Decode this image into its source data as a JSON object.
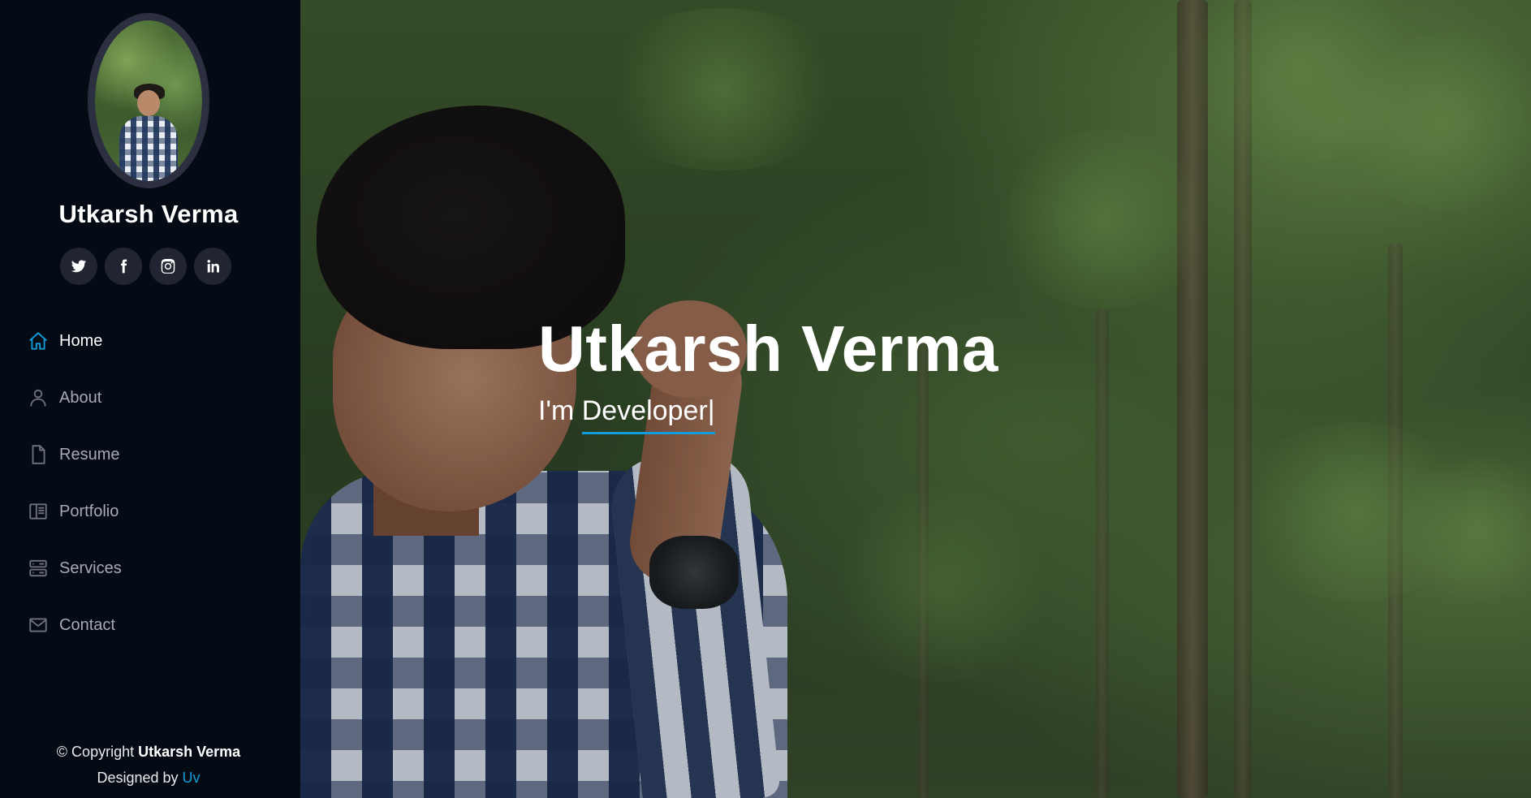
{
  "profile": {
    "name": "Utkarsh Verma",
    "avatar_alt": "profile photo"
  },
  "social": [
    {
      "icon": "twitter-icon"
    },
    {
      "icon": "facebook-icon"
    },
    {
      "icon": "instagram-icon"
    },
    {
      "icon": "linkedin-icon"
    }
  ],
  "nav": {
    "items": [
      {
        "label": "Home",
        "icon": "home-icon",
        "active": true
      },
      {
        "label": "About",
        "icon": "person-icon",
        "active": false
      },
      {
        "label": "Resume",
        "icon": "file-icon",
        "active": false
      },
      {
        "label": "Portfolio",
        "icon": "book-icon",
        "active": false
      },
      {
        "label": "Services",
        "icon": "server-icon",
        "active": false
      },
      {
        "label": "Contact",
        "icon": "envelope-icon",
        "active": false
      }
    ]
  },
  "footer": {
    "copyright_prefix": "© Copyright",
    "copyright_name": "Utkarsh Verma",
    "designed_by": "Designed by",
    "designer": "Uv"
  },
  "hero": {
    "title": "Utkarsh Verma",
    "subtitle_prefix": "I'm",
    "typed_text": "Developer",
    "cursor": "|"
  },
  "colors": {
    "sidebar_bg": "#040b14",
    "accent": "#149ddd",
    "social_bg": "#212431"
  }
}
